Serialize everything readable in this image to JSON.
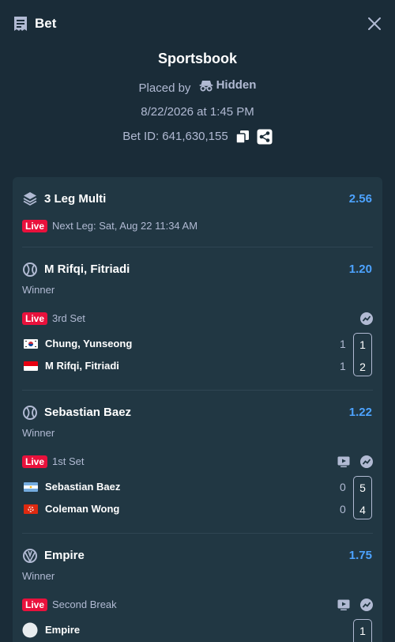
{
  "header": {
    "title": "Bet"
  },
  "summary": {
    "book": "Sportsbook",
    "placed_label": "Placed by",
    "placed_user": "Hidden",
    "datetime": "8/22/2026 at 1:45 PM",
    "bet_id": "Bet ID: 641,630,155"
  },
  "multi": {
    "title": "3 Leg Multi",
    "odds": "2.56",
    "live_badge": "Live",
    "next_leg": "Next Leg: Sat, Aug 22 11:34 AM"
  },
  "legs": [
    {
      "title": "M Rifqi, Fitriadi",
      "odds": "1.20",
      "market": "Winner",
      "live_badge": "Live",
      "status": "3rd Set",
      "players": [
        {
          "name": "Chung, Yunseong",
          "flag": "korea-flag-icon",
          "score": "1",
          "set": "1"
        },
        {
          "name": "M Rifqi, Fitriadi",
          "flag": "indonesia-flag-icon",
          "score": "1",
          "set": "2"
        }
      ]
    },
    {
      "title": "Sebastian Baez",
      "odds": "1.22",
      "market": "Winner",
      "live_badge": "Live",
      "status": "1st Set",
      "players": [
        {
          "name": "Sebastian Baez",
          "flag": "argentina-flag-icon",
          "score": "0",
          "set": "5"
        },
        {
          "name": "Coleman Wong",
          "flag": "hong-kong-flag-icon",
          "score": "0",
          "set": "4"
        }
      ]
    },
    {
      "title": "Empire",
      "odds": "1.75",
      "market": "Winner",
      "live_badge": "Live",
      "status": "Second Break",
      "players": [
        {
          "name": "Empire",
          "flag": "team-logo-icon",
          "set": "1"
        }
      ]
    }
  ],
  "colors": {
    "background": "#1a2c38",
    "card": "#213743",
    "accent_odds": "#4da3ff",
    "live": "#e9113c",
    "muted_text": "#b1bad3"
  }
}
